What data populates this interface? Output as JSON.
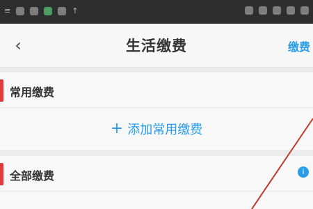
{
  "status_bar": {
    "left_text": "≡",
    "right_text": "↑"
  },
  "nav": {
    "back_glyph": "‹",
    "title": "生活缴费",
    "action_label": "缴费"
  },
  "sections": [
    {
      "title": "常用缴费",
      "add_label": "添加常用缴费",
      "add_glyph": "+"
    },
    {
      "title": "全部缴费",
      "right_icon": "i"
    }
  ],
  "colors": {
    "accent": "#2a9de8",
    "marker": "#e23b3b",
    "annotation_line": "#c0392b"
  }
}
